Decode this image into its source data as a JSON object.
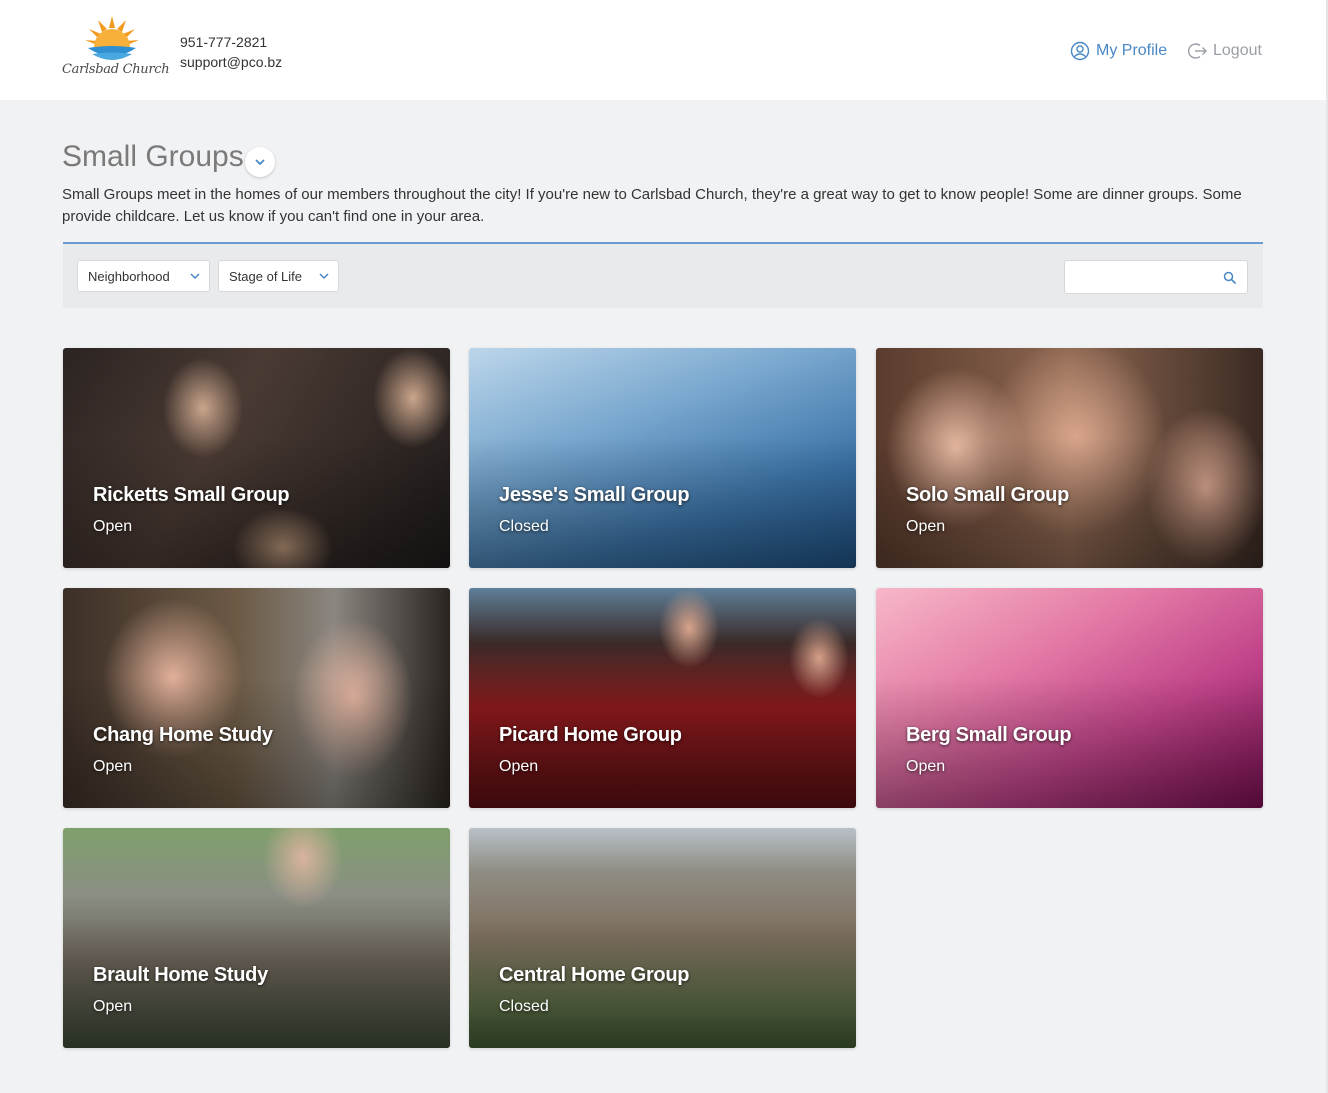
{
  "header": {
    "logo_text": "Carlsbad Church",
    "phone": "951-777-2821",
    "email": "support@pco.bz",
    "profile_label": "My Profile",
    "logout_label": "Logout"
  },
  "page": {
    "title": "Small Groups",
    "description": "Small Groups meet in the homes of our members throughout the city! If you're new to Carlsbad Church, they're a great way to get to know people! Some are dinner groups. Some provide childcare. Let us know if you can't find one in your area."
  },
  "filters": {
    "neighborhood_label": "Neighborhood",
    "stage_label": "Stage of Life",
    "search_placeholder": ""
  },
  "groups": [
    {
      "name": "Ricketts Small Group",
      "status": "Open"
    },
    {
      "name": "Jesse's Small Group",
      "status": "Closed"
    },
    {
      "name": "Solo Small Group",
      "status": "Open"
    },
    {
      "name": "Chang Home Study",
      "status": "Open"
    },
    {
      "name": "Picard Home Group",
      "status": "Open"
    },
    {
      "name": "Berg Small Group",
      "status": "Open"
    },
    {
      "name": "Brault Home Study",
      "status": "Open"
    },
    {
      "name": "Central Home Group",
      "status": "Closed"
    }
  ],
  "colors": {
    "accent": "#4a87c5",
    "filter_rule": "#6a9bd4",
    "background": "#f1f2f4"
  }
}
